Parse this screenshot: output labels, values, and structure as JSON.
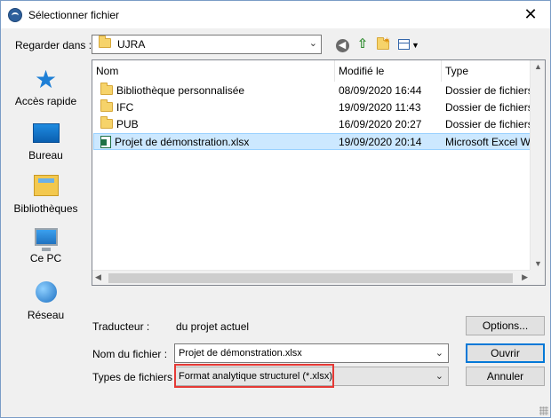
{
  "window": {
    "title": "Sélectionner fichier",
    "close_glyph": "✕"
  },
  "toolbar": {
    "look_in_label": "Regarder dans :",
    "look_in_value": "UJRA",
    "icons": [
      "back-icon",
      "up-folder-icon",
      "new-folder-icon",
      "view-menu-icon"
    ]
  },
  "places": [
    {
      "label": "Accès rapide",
      "icon": "star-icon"
    },
    {
      "label": "Bureau",
      "icon": "desktop-icon"
    },
    {
      "label": "Bibliothèques",
      "icon": "libraries-icon"
    },
    {
      "label": "Ce PC",
      "icon": "computer-icon"
    },
    {
      "label": "Réseau",
      "icon": "network-icon"
    }
  ],
  "file_list": {
    "columns": [
      "Nom",
      "Modifié le",
      "Type"
    ],
    "rows": [
      {
        "name": "Bibliothèque personnalisée",
        "date": "08/09/2020 16:44",
        "type": "Dossier de fichiers",
        "icon": "folder-icon",
        "selected": false
      },
      {
        "name": "IFC",
        "date": "19/09/2020 11:43",
        "type": "Dossier de fichiers",
        "icon": "folder-icon",
        "selected": false
      },
      {
        "name": "PUB",
        "date": "16/09/2020 20:27",
        "type": "Dossier de fichiers",
        "icon": "folder-icon",
        "selected": false
      },
      {
        "name": "Projet de démonstration.xlsx",
        "date": "19/09/2020 20:14",
        "type": "Microsoft Excel W...",
        "icon": "excel-file-icon",
        "selected": true
      }
    ]
  },
  "bottom": {
    "translator_label": "Traducteur :",
    "translator_value": "du projet actuel",
    "options_button": "Options...",
    "filename_label": "Nom du fichier :",
    "filename_value": "Projet de démonstration.xlsx",
    "filetypes_label": "Types de fichiers :",
    "filetypes_value": "Format analytique structurel (*.xlsx)",
    "open_button": "Ouvrir",
    "cancel_button": "Annuler"
  },
  "colors": {
    "selection_bg": "#cce8ff",
    "highlight_box": "#e53935",
    "accent": "#0078d7"
  }
}
